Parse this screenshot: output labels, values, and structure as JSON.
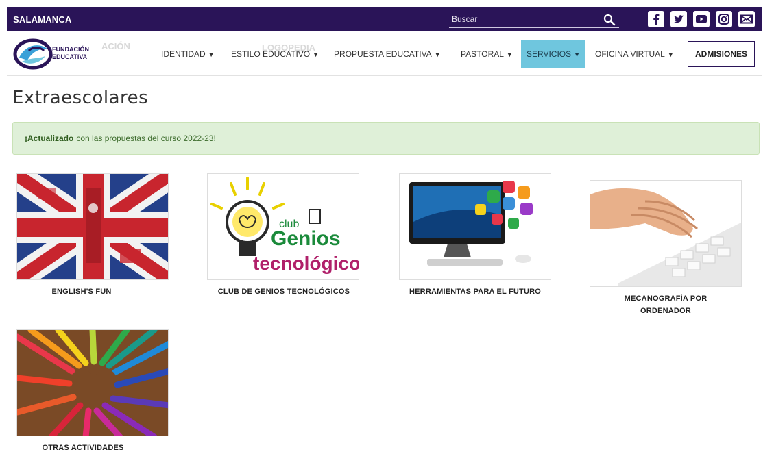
{
  "header": {
    "city": "SALAMANCA",
    "search_placeholder": "Buscar",
    "social": [
      "facebook-icon",
      "twitter-icon",
      "youtube-icon",
      "instagram-icon",
      "mail-icon"
    ]
  },
  "nav": {
    "logo_text_top": "FUNDACIÓN",
    "logo_text_bottom": "EDUCATIVA",
    "ghost_left": "ACIÓN",
    "ghost_center": "LOGOPEDIA",
    "items": [
      {
        "label": "IDENTIDAD"
      },
      {
        "label": "ESTILO EDUCATIVO"
      },
      {
        "label": "PROPUESTA EDUCATIVA"
      },
      {
        "label": "PASTORAL"
      },
      {
        "label": "SERVICIOS"
      },
      {
        "label": "OFICINA VIRTUAL"
      }
    ],
    "admissions": "ADMISIONES"
  },
  "page": {
    "title": "Extraescolares",
    "alert_bold": "¡Actualizado",
    "alert_rest": "con las propuestas del curso 2022-23!"
  },
  "activities": [
    {
      "title": "ENGLISH'S FUN"
    },
    {
      "title": "CLUB DE GENIOS TECNOLÓGICOS",
      "image_text_1": "club",
      "image_text_2": "Genios",
      "image_text_3": "tecnológicos"
    },
    {
      "title": "HERRAMIENTAS PARA EL FUTURO"
    },
    {
      "title": "MECANOGRAFÍA POR ORDENADOR",
      "title_line1": "MECANOGRAFÍA POR",
      "title_line2": "ORDENADOR"
    },
    {
      "title": "OTRAS ACTIVIDADES"
    }
  ],
  "colors": {
    "brand_purple": "#2a1458",
    "active_nav": "#6fc6de",
    "alert_bg": "#dff0d8"
  }
}
